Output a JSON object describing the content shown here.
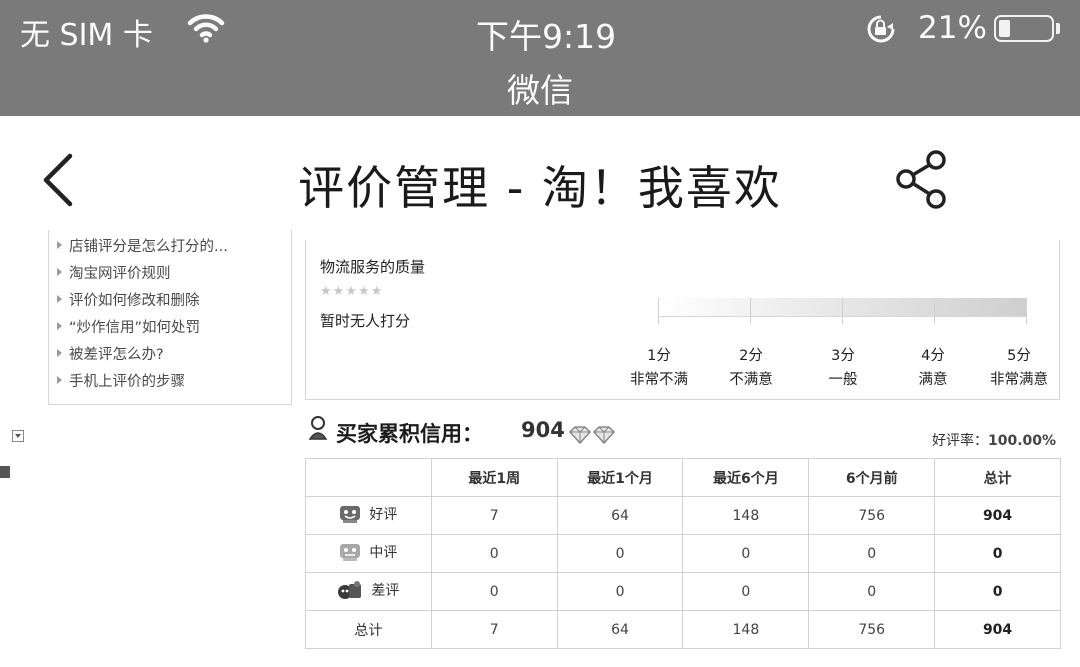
{
  "status_bar": {
    "carrier": "无 SIM 卡",
    "time": "下午9:19",
    "battery_percent": "21%",
    "battery_level": 0.21,
    "app_name": "微信"
  },
  "nav": {
    "title": "评价管理 - 淘！我喜欢"
  },
  "help_links": [
    "店铺评分是怎么打分的...",
    "淘宝网评价规则",
    "评价如何修改和删除",
    "“炒作信用”如何处罚",
    "被差评怎么办?",
    "手机上评价的步骤"
  ],
  "service_rating": {
    "title": "物流服务的质量",
    "stars": "★★★★★",
    "no_rating": "暂时无人打分",
    "scale": [
      {
        "score": "1分",
        "label": "非常不满"
      },
      {
        "score": "2分",
        "label": "不满意"
      },
      {
        "score": "3分",
        "label": "一般"
      },
      {
        "score": "4分",
        "label": "满意"
      },
      {
        "score": "5分",
        "label": "非常满意"
      }
    ]
  },
  "credit": {
    "title": "买家累积信用：",
    "score": "904",
    "good_rate_label": "好评率：",
    "good_rate_value": "100.00%"
  },
  "table": {
    "headers": [
      "",
      "最近1周",
      "最近1个月",
      "最近6个月",
      "6个月前",
      "总计"
    ],
    "rows": [
      {
        "label": "好评",
        "icon": "good-rating-icon",
        "values": [
          "7",
          "64",
          "148",
          "756",
          "904"
        ]
      },
      {
        "label": "中评",
        "icon": "neutral-rating-icon",
        "values": [
          "0",
          "0",
          "0",
          "0",
          "0"
        ]
      },
      {
        "label": "差评",
        "icon": "bad-rating-icon",
        "values": [
          "0",
          "0",
          "0",
          "0",
          "0"
        ]
      },
      {
        "label": "总计",
        "icon": "",
        "values": [
          "7",
          "64",
          "148",
          "756",
          "904"
        ]
      }
    ]
  },
  "colors": {
    "status_bar_bg": "#7a7a7a",
    "page_bg": "#ffffff"
  }
}
